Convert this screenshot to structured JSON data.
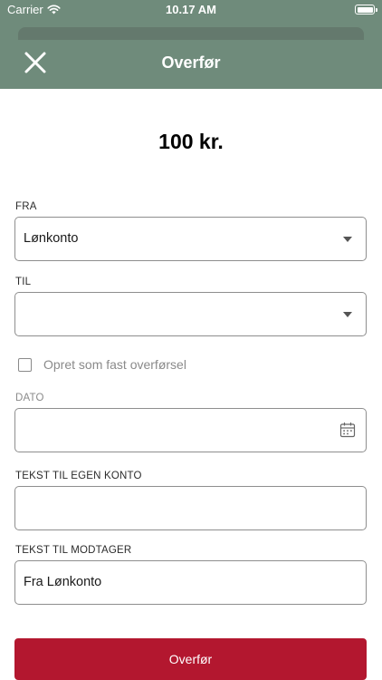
{
  "status_bar": {
    "carrier": "Carrier",
    "time": "10.17 AM",
    "wifi_icon": "wifi-icon",
    "battery_icon": "battery-icon"
  },
  "header": {
    "title": "Overfør",
    "close_icon": "close-icon",
    "background_color": "#6f8b7b"
  },
  "amount": "100 kr.",
  "form": {
    "from": {
      "label": "FRA",
      "value": "Lønkonto"
    },
    "to": {
      "label": "TIL",
      "value": ""
    },
    "recurring": {
      "label": "Opret som fast overførsel",
      "checked": false
    },
    "date": {
      "label": "DATO",
      "value": "",
      "icon": "calendar-icon"
    },
    "text_own": {
      "label": "TEKST TIL EGEN KONTO",
      "value": ""
    },
    "text_recipient": {
      "label": "TEKST TIL MODTAGER",
      "value": "Fra Lønkonto"
    }
  },
  "submit": {
    "label": "Overfør",
    "color": "#b3172f"
  }
}
